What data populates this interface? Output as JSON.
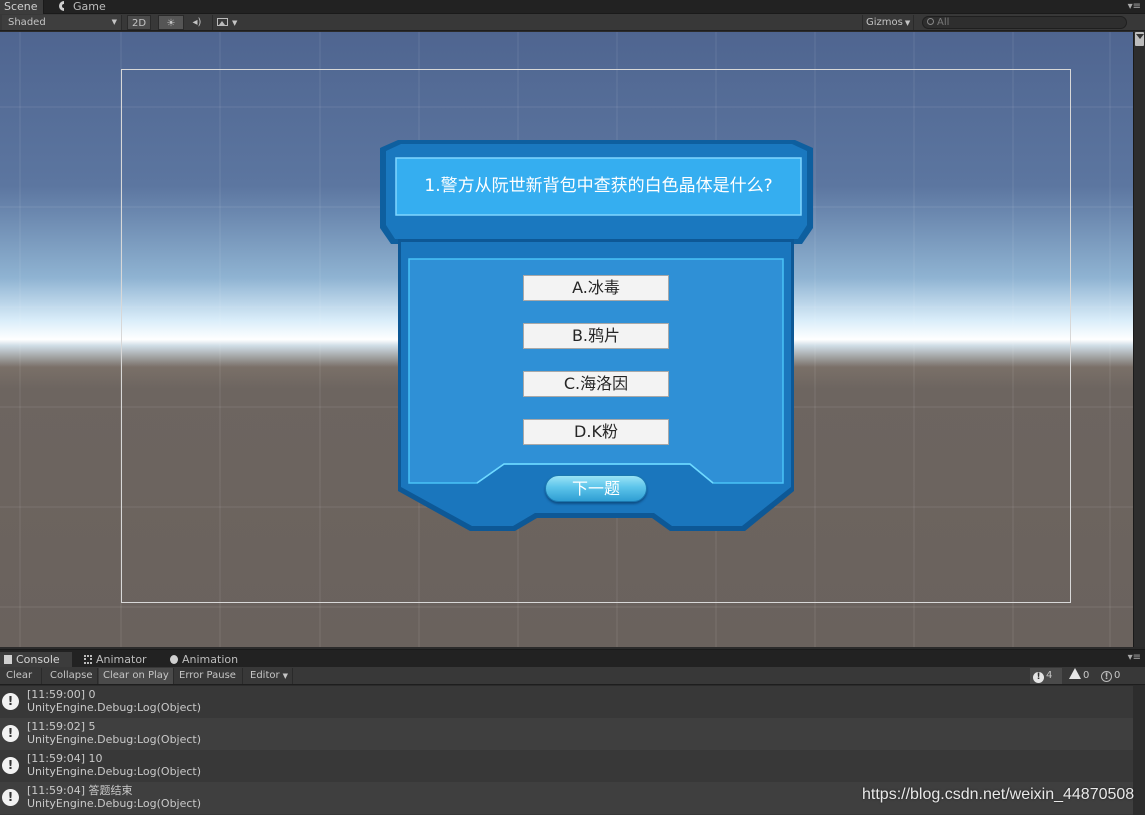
{
  "tabs": {
    "scene": "Scene",
    "game": "Game",
    "menu_glyph": "▾≡"
  },
  "scene_toolbar": {
    "shading_mode": "Shaded",
    "mode_2d": "2D",
    "light_icon": "sun-icon",
    "audio_icon": "speaker-icon",
    "effects_icon": "image-icon",
    "gizmos": "Gizmos",
    "search_placeholder": "All"
  },
  "quiz": {
    "question": "1.警方从阮世新背包中查获的白色晶体是什么?",
    "options": [
      "A.冰毒",
      "B.鸦片",
      "C.海洛因",
      "D.K粉"
    ],
    "next_button": "下一题",
    "colors": {
      "panel_dark": "#0d5d9c",
      "panel_mid": "#1c7ec7",
      "panel_light": "#2e8fd6",
      "header_light": "#35aef0"
    }
  },
  "console_tabs": {
    "console": "Console",
    "animator": "Animator",
    "animation": "Animation"
  },
  "console_toolbar": {
    "clear": "Clear",
    "collapse": "Collapse",
    "clear_on_play": "Clear on Play",
    "error_pause": "Error Pause",
    "editor": "Editor",
    "log_count": "4",
    "warning_count": "0",
    "error_count": "0"
  },
  "console_logs": [
    {
      "line1": "[11:59:00] 0",
      "line2": "UnityEngine.Debug:Log(Object)"
    },
    {
      "line1": "[11:59:02] 5",
      "line2": "UnityEngine.Debug:Log(Object)"
    },
    {
      "line1": "[11:59:04] 10",
      "line2": "UnityEngine.Debug:Log(Object)"
    },
    {
      "line1": "[11:59:04] 答题结束",
      "line2": "UnityEngine.Debug:Log(Object)"
    }
  ],
  "watermark": "https://blog.csdn.net/weixin_44870508"
}
